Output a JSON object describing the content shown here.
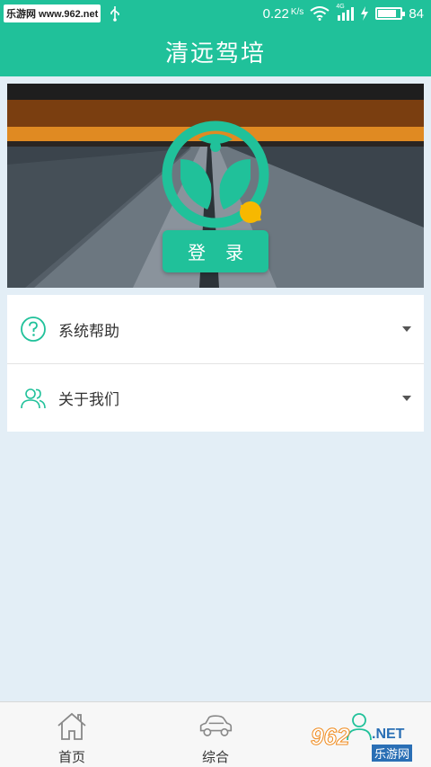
{
  "status_bar": {
    "watermark": "乐游网 www.962.net",
    "network_speed": "0.22",
    "speed_unit": "K/s",
    "network_type": "4G",
    "battery": "84",
    "battery_level": 0.84
  },
  "header": {
    "title": "清远驾培"
  },
  "banner": {
    "login_label": "登录"
  },
  "menu": {
    "items": [
      {
        "label": "系统帮助",
        "icon": "question-icon"
      },
      {
        "label": "关于我们",
        "icon": "users-icon"
      }
    ]
  },
  "tabbar": {
    "tabs": [
      {
        "label": "首页",
        "icon": "home-icon"
      },
      {
        "label": "综合",
        "icon": "car-icon"
      },
      {
        "label": "",
        "icon": "user-icon"
      }
    ]
  },
  "watermark": {
    "number": "962",
    "domain": ".NET",
    "site_name": "乐游网"
  },
  "colors": {
    "primary": "#20c19a",
    "background": "#e3eef6",
    "logo_accent": "#f7b800"
  }
}
